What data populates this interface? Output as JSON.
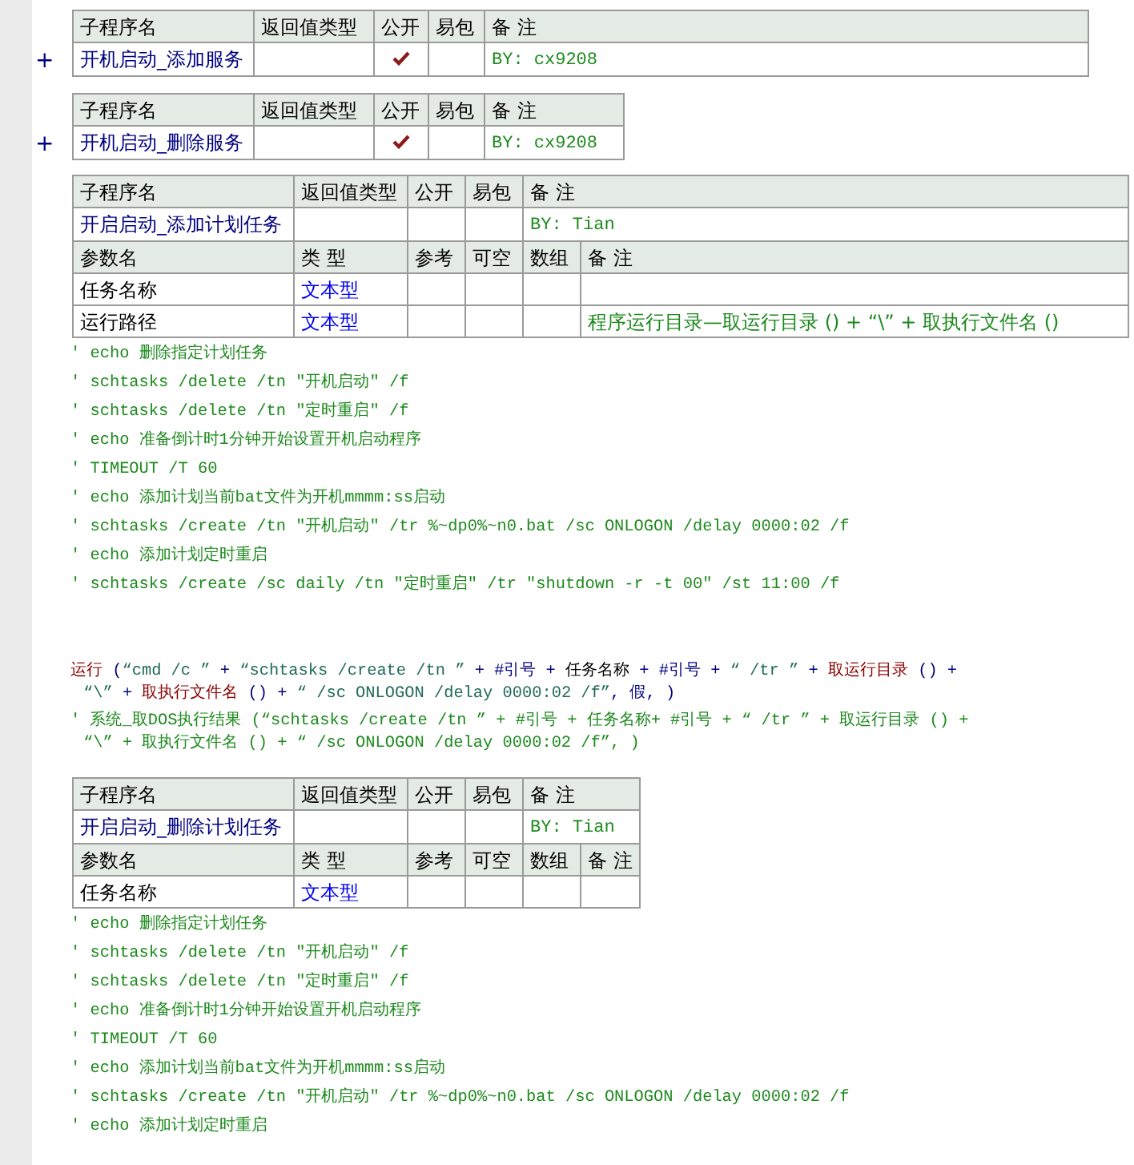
{
  "blocks": [
    {
      "kind": "subroutine",
      "toggle": "+",
      "header": [
        "子程序名",
        "返回值类型",
        "公开",
        "易包",
        "备 注"
      ],
      "name": "开机启动_添加服务",
      "public": true,
      "remark": "BY: cx9208"
    },
    {
      "kind": "subroutine",
      "toggle": "+",
      "header": [
        "子程序名",
        "返回值类型",
        "公开",
        "易包",
        "备 注"
      ],
      "name": "开机启动_删除服务",
      "public": true,
      "remark": "BY: cx9208"
    },
    {
      "kind": "subroutine",
      "header": [
        "子程序名",
        "返回值类型",
        "公开",
        "易包",
        "备 注"
      ],
      "name": "开启启动_添加计划任务",
      "public": false,
      "remark": "BY: Tian",
      "params_header": [
        "参数名",
        "类 型",
        "参考",
        "可空",
        "数组",
        "备 注"
      ],
      "params": [
        {
          "name": "任务名称",
          "type": "文本型"
        },
        {
          "name": "运行路径",
          "type": "文本型",
          "remark": "程序运行目录—取运行目录 () + “\\” + 取执行文件名 ()"
        }
      ]
    },
    {
      "kind": "code",
      "statements": [
        {
          "lines": [
            [
              {
                "kind": "comment",
                "text": "' echo 删除指定计划任务"
              }
            ]
          ]
        },
        {
          "lines": [
            [
              {
                "kind": "comment",
                "text": "' schtasks /delete /tn \"开机启动\" /f"
              }
            ]
          ]
        },
        {
          "lines": [
            [
              {
                "kind": "comment",
                "text": "' schtasks /delete /tn \"定时重启\" /f"
              }
            ]
          ]
        },
        {
          "lines": [
            [
              {
                "kind": "comment",
                "text": "' echo 准备倒计时1分钟开始设置开机启动程序"
              }
            ]
          ]
        },
        {
          "lines": [
            [
              {
                "kind": "comment",
                "text": "' TIMEOUT /T 60"
              }
            ]
          ]
        },
        {
          "lines": [
            [
              {
                "kind": "comment",
                "text": "' echo 添加计划当前bat文件为开机mmmm:ss启动"
              }
            ]
          ]
        },
        {
          "lines": [
            [
              {
                "kind": "comment",
                "text": "' schtasks /create /tn \"开机启动\" /tr %~dp0%~n0.bat /sc ONLOGON /delay 0000:02 /f"
              }
            ]
          ]
        },
        {
          "lines": [
            [
              {
                "kind": "comment",
                "text": "' echo 添加计划定时重启"
              }
            ]
          ]
        },
        {
          "lines": [
            [
              {
                "kind": "comment",
                "text": "' schtasks /create /sc daily /tn \"定时重启\" /tr \"shutdown -r -t 00\" /st 11:00 /f"
              }
            ]
          ]
        }
      ]
    },
    {
      "kind": "code",
      "statements": [
        {
          "lines": [
            [
              {
                "kind": "call",
                "text": "运行"
              },
              {
                "kind": "op",
                "text": " ("
              },
              {
                "kind": "str",
                "text": "“cmd /c ”"
              },
              {
                "kind": "op",
                "text": " + "
              },
              {
                "kind": "str",
                "text": "“schtasks /create /tn ”"
              },
              {
                "kind": "op",
                "text": " + #引号 + "
              },
              {
                "kind": "name",
                "text": "任务名称"
              },
              {
                "kind": "op",
                "text": " + #引号 + "
              },
              {
                "kind": "str",
                "text": "“ /tr ”"
              },
              {
                "kind": "op",
                "text": " + "
              },
              {
                "kind": "call",
                "text": "取运行目录"
              },
              {
                "kind": "op",
                "text": " () +"
              }
            ],
            [
              {
                "kind": "str",
                "text": "“\\”"
              },
              {
                "kind": "op",
                "text": " + "
              },
              {
                "kind": "call",
                "text": "取执行文件名"
              },
              {
                "kind": "op",
                "text": " () + "
              },
              {
                "kind": "str",
                "text": "“ /sc ONLOGON /delay 0000:02 /f”"
              },
              {
                "kind": "op",
                "text": ", 假, )"
              }
            ]
          ]
        },
        {
          "lines": [
            [
              {
                "kind": "comment",
                "text": "' 系统_取DOS执行结果 (“schtasks /create /tn ” + #引号 + 任务名称+ #引号 + “ /tr ” + 取运行目录 () +"
              }
            ],
            [
              {
                "kind": "comment",
                "text": "“\\” + 取执行文件名 () + “ /sc ONLOGON /delay 0000:02 /f”, )"
              }
            ]
          ]
        }
      ]
    },
    {
      "kind": "subroutine",
      "header": [
        "子程序名",
        "返回值类型",
        "公开",
        "易包",
        "备 注"
      ],
      "name": "开启启动_删除计划任务",
      "public": false,
      "remark": "BY: Tian",
      "params_header": [
        "参数名",
        "类 型",
        "参考",
        "可空",
        "数组",
        "备 注"
      ],
      "params": [
        {
          "name": "任务名称",
          "type": "文本型"
        }
      ]
    },
    {
      "kind": "code",
      "statements": [
        {
          "lines": [
            [
              {
                "kind": "comment",
                "text": "' echo 删除指定计划任务"
              }
            ]
          ]
        },
        {
          "lines": [
            [
              {
                "kind": "comment",
                "text": "' schtasks /delete /tn \"开机启动\" /f"
              }
            ]
          ]
        },
        {
          "lines": [
            [
              {
                "kind": "comment",
                "text": "' schtasks /delete /tn \"定时重启\" /f"
              }
            ]
          ]
        },
        {
          "lines": [
            [
              {
                "kind": "comment",
                "text": "' echo 准备倒计时1分钟开始设置开机启动程序"
              }
            ]
          ]
        },
        {
          "lines": [
            [
              {
                "kind": "comment",
                "text": "' TIMEOUT /T 60"
              }
            ]
          ]
        },
        {
          "lines": [
            [
              {
                "kind": "comment",
                "text": "' echo 添加计划当前bat文件为开机mmmm:ss启动"
              }
            ]
          ]
        },
        {
          "lines": [
            [
              {
                "kind": "comment",
                "text": "' schtasks /create /tn \"开机启动\" /tr %~dp0%~n0.bat /sc ONLOGON /delay 0000:02 /f"
              }
            ]
          ]
        },
        {
          "lines": [
            [
              {
                "kind": "comment",
                "text": "' echo 添加计划定时重启"
              }
            ]
          ]
        }
      ]
    }
  ]
}
